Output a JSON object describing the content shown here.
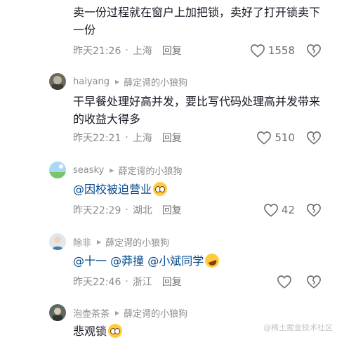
{
  "comments": [
    {
      "username": "",
      "reply_to": "",
      "text": "卖一份过程就在窗户上加把锁，卖好了打开锁卖下一份",
      "time": "昨天21:26",
      "location": "上海",
      "reply_label": "回复",
      "likes": "1558"
    },
    {
      "username": "haiyang",
      "reply_to": "薛定谔的小狼狗",
      "text": "干早餐处理好高并发，要比写代码处理高并发带来的收益大得多",
      "time": "昨天22:21",
      "location": "上海",
      "reply_label": "回复",
      "likes": "510"
    },
    {
      "username": "seasky",
      "reply_to": "薛定谔的小狼狗",
      "text": "@因校被迫营业",
      "time": "昨天22:29",
      "location": "湖北",
      "reply_label": "回复",
      "likes": "42"
    },
    {
      "username": "除非",
      "reply_to": "薛定谔的小狼狗",
      "mentions": [
        "@十一",
        "@莽撞",
        "@小斌同学"
      ],
      "time": "昨天22:46",
      "location": "浙江",
      "reply_label": "回复",
      "likes": ""
    },
    {
      "username": "泡壶茶茶",
      "reply_to": "薛定谔的小狼狗",
      "text": "悲观锁"
    }
  ],
  "watermark": "@稀土掘金技术社区",
  "icons": {
    "like": "heart-outline-icon",
    "dislike": "broken-heart-icon",
    "reply_arrow": "triangle-right-icon"
  },
  "colors": {
    "text": "#161823",
    "secondary": "#8a8b91",
    "mention": "#04498d"
  }
}
